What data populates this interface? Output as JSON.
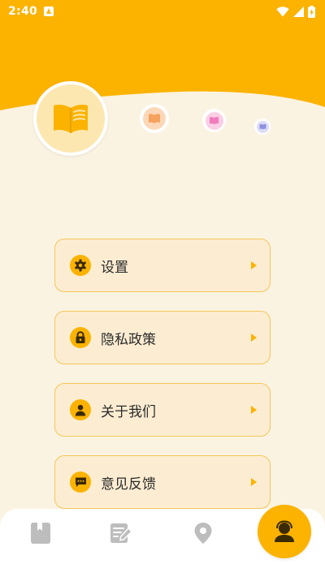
{
  "status_bar": {
    "time": "2:40",
    "icons": [
      "notification-icon",
      "wifi-icon",
      "signal-icon",
      "battery-charging-icon"
    ]
  },
  "theme": {
    "accent": "#fbb300",
    "background": "#fbf3e1",
    "card_background": "#fcedd2",
    "card_border": "#f4c65a",
    "nav_inactive": "#bdbdbd"
  },
  "profile": {
    "avatar_icon": "book-icon",
    "decorations": [
      "book-icon",
      "book-icon",
      "book-icon"
    ]
  },
  "menu": {
    "items": [
      {
        "label": "设置",
        "icon": "gear-icon"
      },
      {
        "label": "隐私政策",
        "icon": "lock-icon"
      },
      {
        "label": "关于我们",
        "icon": "person-icon"
      },
      {
        "label": "意见反馈",
        "icon": "chat-icon"
      }
    ]
  },
  "bottom_nav": {
    "tabs": [
      {
        "icon": "bookmark-icon",
        "active": false
      },
      {
        "icon": "edit-note-icon",
        "active": false
      },
      {
        "icon": "location-pin-icon",
        "active": false
      },
      {
        "icon": "user-icon",
        "active": true
      }
    ]
  }
}
